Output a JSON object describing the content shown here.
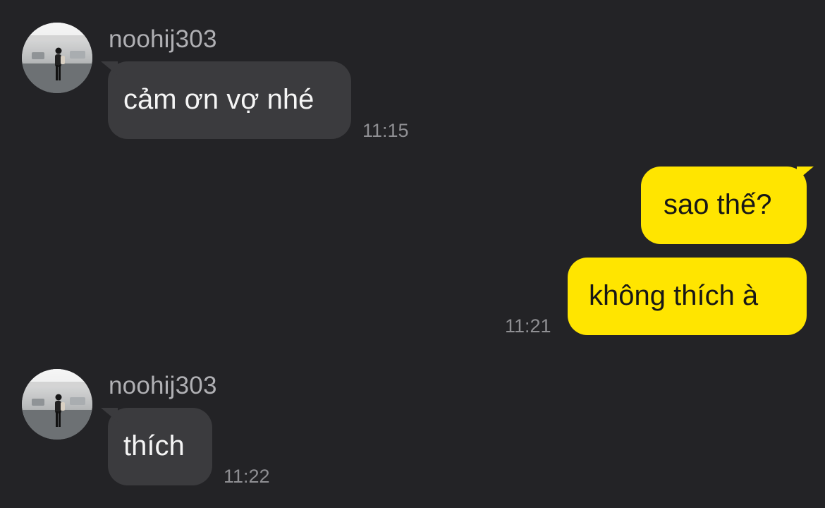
{
  "conversation": {
    "messages": [
      {
        "sender": "noohij303",
        "text": "cảm ơn vợ nhé",
        "time": "11:15",
        "direction": "incoming"
      },
      {
        "text": "sao thế?",
        "direction": "outgoing"
      },
      {
        "text": "không thích à",
        "time": "11:21",
        "direction": "outgoing"
      },
      {
        "sender": "noohij303",
        "text": "thích",
        "time": "11:22",
        "direction": "incoming"
      }
    ]
  },
  "colors": {
    "background": "#232326",
    "incoming_bubble": "#3b3b3e",
    "outgoing_bubble": "#ffe500",
    "sender_text": "#b0b0b4",
    "timestamp_text": "#8f8f93"
  }
}
